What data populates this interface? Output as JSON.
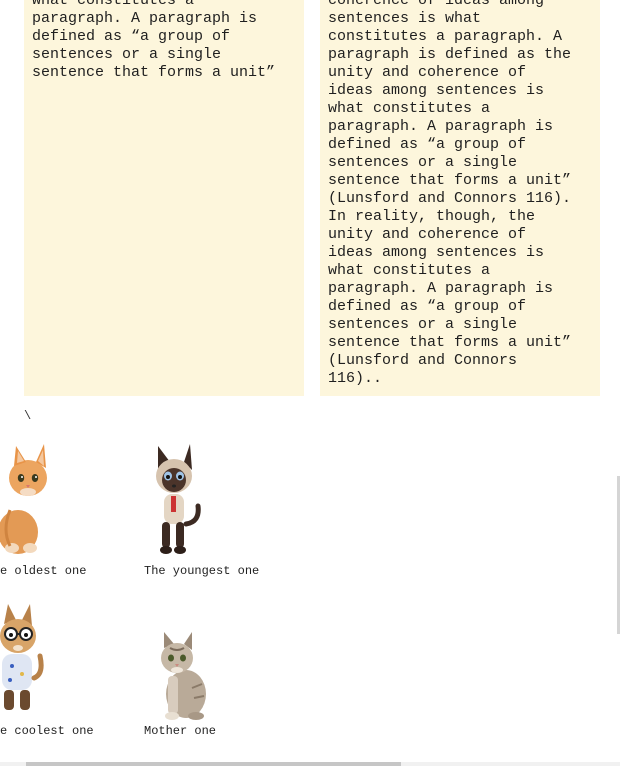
{
  "columns": {
    "left": [
      "what constitutes a",
      "paragraph. A paragraph is",
      "defined as “a group of",
      "sentences or a single",
      "sentence that forms a unit”"
    ],
    "right": [
      "coherence of ideas among",
      "sentences is what",
      "constitutes a paragraph. A",
      "paragraph is defined as the",
      "unity and coherence of",
      "ideas among sentences is",
      "what constitutes a",
      "paragraph. A paragraph is",
      "defined as “a group of",
      "sentences or a single",
      "sentence that forms a unit”",
      "(Lunsford and Connors 116).",
      "In reality, though, the",
      "unity and coherence of",
      "ideas among sentences is",
      "what constitutes a",
      "paragraph. A paragraph is",
      "defined as “a group of",
      "sentences or a single",
      "sentence that forms a unit”",
      "(Lunsford and Connors",
      "116).."
    ]
  },
  "stray_mark": "\\",
  "gallery": {
    "items": [
      {
        "caption": "e oldest one",
        "icon": "orange-kitten-icon"
      },
      {
        "caption": "The youngest one",
        "icon": "siamese-cat-icon"
      },
      {
        "caption": "e coolest one",
        "icon": "cool-cat-with-glasses-icon"
      },
      {
        "caption": "Mother one",
        "icon": "tabby-cat-icon"
      }
    ]
  }
}
